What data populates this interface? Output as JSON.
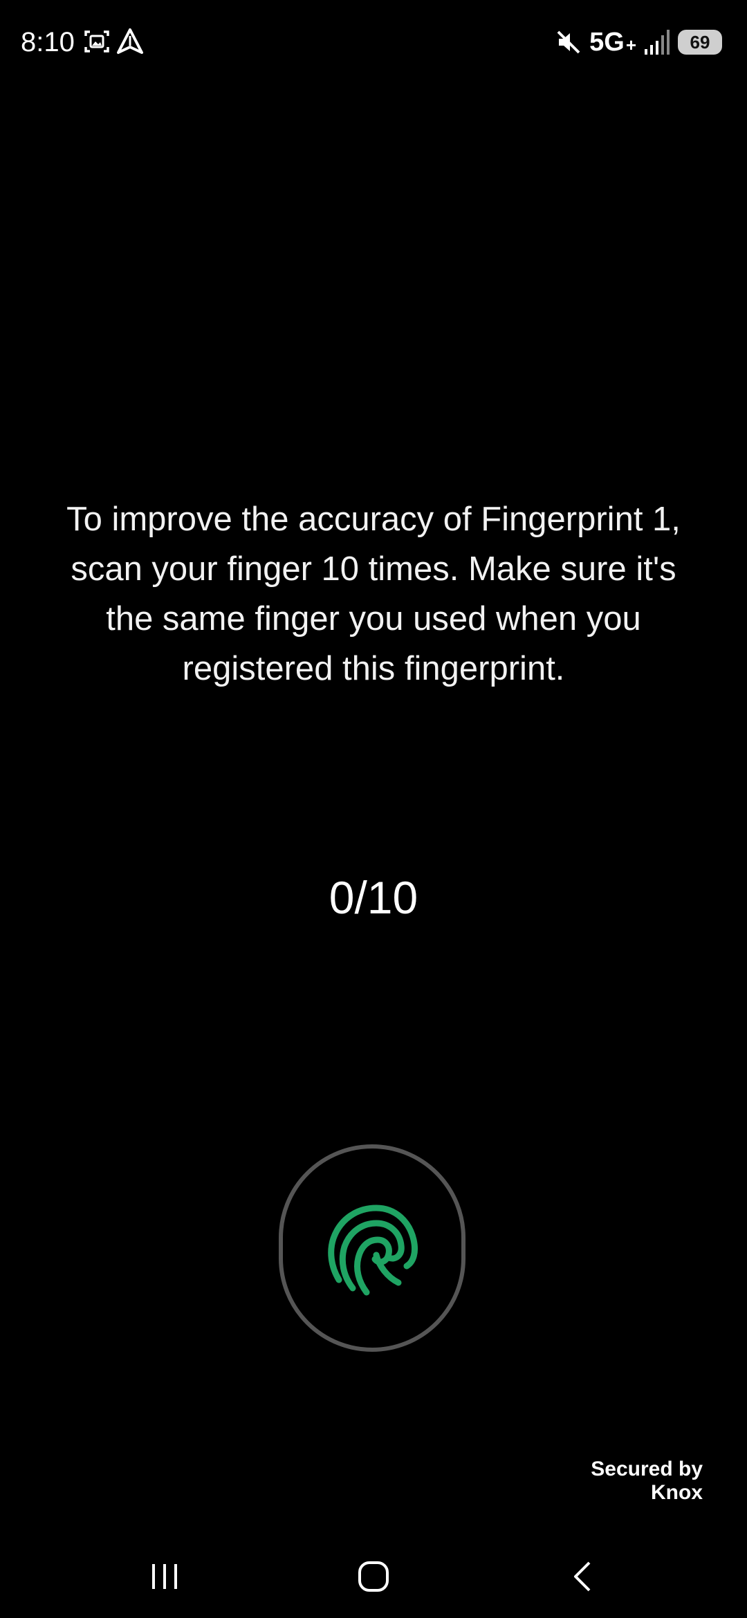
{
  "status_bar": {
    "time": "8:10",
    "left_icons": [
      "screenshot-icon",
      "navigation-arrow-icon"
    ],
    "right_icons": [
      "mute-icon",
      "signal-icon"
    ],
    "network": "5G",
    "network_suffix": "+",
    "battery_level": "69"
  },
  "enrollment": {
    "instructions": "To improve the accuracy of Fingerprint 1, scan your finger 10 times. Make sure it's the same finger you used when you registered this fingerprint.",
    "progress": "0/10",
    "progress_value": 0,
    "progress_total": 10,
    "sensor_icon": "fingerprint-icon",
    "accent_color": "#1fa463"
  },
  "footer": {
    "secured_by_line1": "Secured by",
    "secured_by_line2": "Knox"
  },
  "nav_bar": {
    "recents_icon": "recents-icon",
    "home_icon": "home-icon",
    "back_icon": "back-icon"
  }
}
